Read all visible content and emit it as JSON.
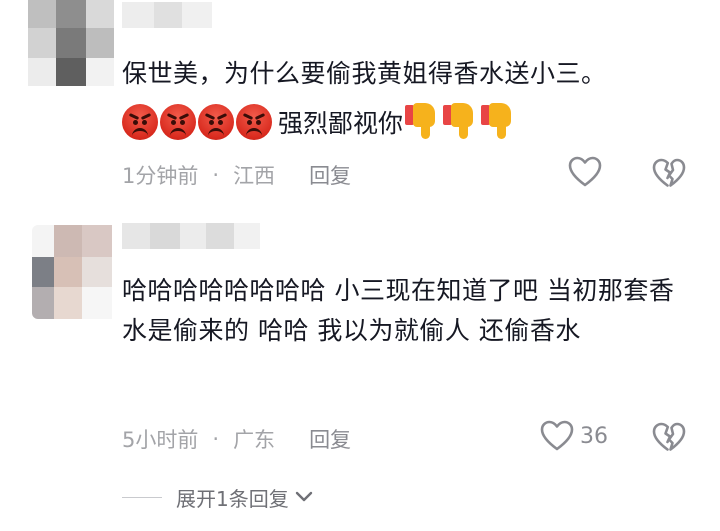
{
  "comments": [
    {
      "text": "保世美，为什么要偷我黄姐得香水送小三。",
      "emoji_text": "强烈鄙视你",
      "time": "1分钟前",
      "dot": "·",
      "location": "江西",
      "reply": "回复",
      "like_count": ""
    },
    {
      "text": "哈哈哈哈哈哈哈哈 小三现在知道了吧 当初那套香水是偷来的 哈哈 我以为就偷人 还偷香水",
      "time": "5小时前",
      "dot": "·",
      "location": "广东",
      "reply": "回复",
      "like_count": "36"
    }
  ],
  "expand": {
    "label": "展开1条回复"
  },
  "icons": {
    "like": "heart-outline-icon",
    "dislike": "broken-heart-icon",
    "expand": "chevron-down-icon",
    "angry": "angry-face-emoji",
    "thumbs_down": "thumbs-down-emoji"
  },
  "colors": {
    "text": "#161823",
    "meta": "#a3a4a8",
    "icon": "#8a8b91",
    "background": "#ffffff"
  }
}
